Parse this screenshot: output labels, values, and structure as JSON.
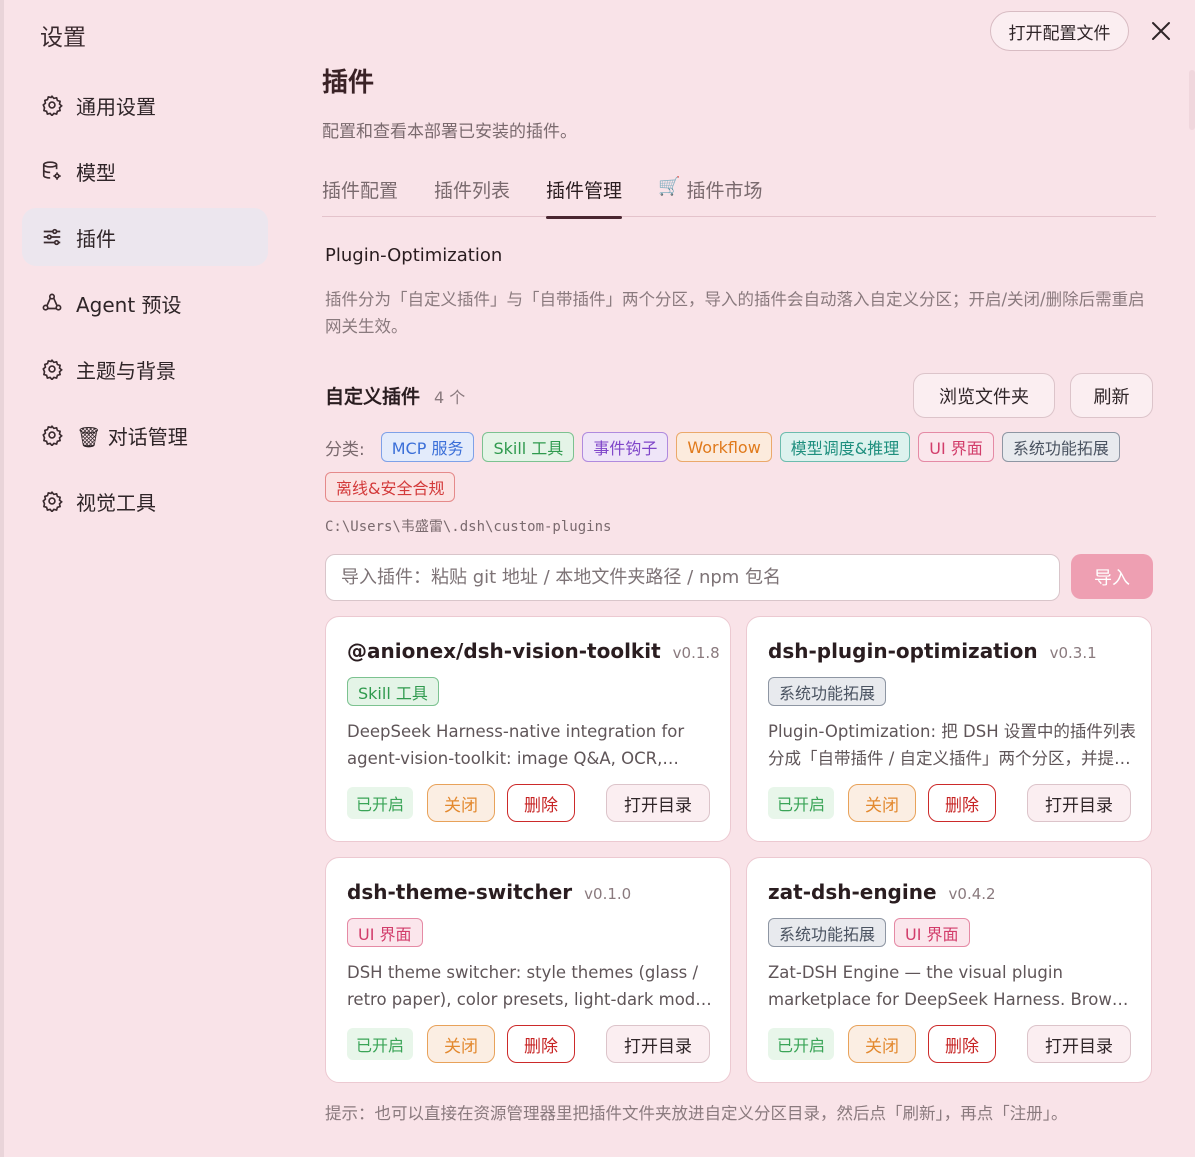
{
  "sidebar": {
    "title": "设置",
    "items": [
      {
        "label": "通用设置",
        "icon": "gear-icon"
      },
      {
        "label": "模型",
        "icon": "database-gear-icon"
      },
      {
        "label": "插件",
        "icon": "sliders-icon",
        "active": true
      },
      {
        "label": "Agent 预设",
        "icon": "agent-icon"
      },
      {
        "label": "主题与背景",
        "icon": "gear-icon"
      },
      {
        "label": "🗑 对话管理",
        "icon": "gear-icon"
      },
      {
        "label": "视觉工具",
        "icon": "gear-icon"
      }
    ]
  },
  "header": {
    "open_config_label": "打开配置文件",
    "close_label": "✕"
  },
  "main": {
    "title": "插件",
    "description": "配置和查看本部署已安装的插件。",
    "tabs": [
      {
        "label": "插件配置"
      },
      {
        "label": "插件列表"
      },
      {
        "label": "插件管理",
        "active": true
      },
      {
        "label": "插件市场",
        "icon": "🛒"
      }
    ]
  },
  "section": {
    "title": "Plugin-Optimization",
    "description": "插件分为「自定义插件」与「自带插件」两个分区，导入的插件会自动落入自定义分区；开启/关闭/删除后需重启网关生效。"
  },
  "custom": {
    "title": "自定义插件",
    "count": "4 个",
    "browse_label": "浏览文件夹",
    "refresh_label": "刷新",
    "category_label": "分类:",
    "categories": [
      {
        "label": "MCP 服务",
        "color": "#3b6fd8",
        "bg": "#e3ebfb"
      },
      {
        "label": "Skill 工具",
        "color": "#2f9a4e",
        "bg": "#e4f4e7"
      },
      {
        "label": "事件钩子",
        "color": "#7f45c9",
        "bg": "#efe5f8"
      },
      {
        "label": "Workflow",
        "color": "#e07a1c",
        "bg": "#fcebdd"
      },
      {
        "label": "模型调度&推理",
        "color": "#1e8f7e",
        "bg": "#ddf2ee"
      },
      {
        "label": "UI 界面",
        "color": "#d23d6b",
        "bg": "#fbe6ec"
      },
      {
        "label": "系统功能拓展",
        "color": "#4a5361",
        "bg": "#e8eaee"
      },
      {
        "label": "离线&安全合规",
        "color": "#d33a3a",
        "bg": "#fbe3e3"
      }
    ],
    "path": "C:\\Users\\韦盛雷\\.dsh\\custom-plugins",
    "import_placeholder": "导入插件：粘贴 git 地址 / 本地文件夹路径 / npm 包名",
    "import_label": "导入"
  },
  "plugins": [
    {
      "name": "@anionex/dsh-vision-toolkit",
      "version": "v0.1.8",
      "tags": [
        {
          "label": "Skill 工具",
          "color": "#2f9a4e",
          "bg": "#e4f4e7"
        }
      ],
      "description": "DeepSeek Harness-native integration for agent-vision-toolkit: image Q&A, OCR, object detection and more.",
      "status": "已开启",
      "close_label": "关闭",
      "delete_label": "删除",
      "open_dir_label": "打开目录"
    },
    {
      "name": "dsh-plugin-optimization",
      "version": "v0.3.1",
      "tags": [
        {
          "label": "系统功能拓展",
          "color": "#4a5361",
          "bg": "#e8eaee"
        }
      ],
      "description": "Plugin-Optimization: 把 DSH 设置中的插件列表分成「自带插件 / 自定义插件」两个分区，并提供导入与管理。",
      "status": "已开启",
      "close_label": "关闭",
      "delete_label": "删除",
      "open_dir_label": "打开目录"
    },
    {
      "name": "dsh-theme-switcher",
      "version": "v0.1.0",
      "tags": [
        {
          "label": "UI 界面",
          "color": "#d23d6b",
          "bg": "#fbe6ec"
        }
      ],
      "description": "DSH theme switcher: style themes (glass / retro paper), color presets, light-dark mode and more.",
      "status": "已开启",
      "close_label": "关闭",
      "delete_label": "删除",
      "open_dir_label": "打开目录"
    },
    {
      "name": "zat-dsh-engine",
      "version": "v0.4.2",
      "tags": [
        {
          "label": "系统功能拓展",
          "color": "#4a5361",
          "bg": "#e8eaee"
        },
        {
          "label": "UI 界面",
          "color": "#d23d6b",
          "bg": "#fbe6ec"
        }
      ],
      "description": "Zat-DSH Engine — the visual plugin marketplace for DeepSeek Harness. Browse, install and manage plugins.",
      "status": "已开启",
      "close_label": "关闭",
      "delete_label": "删除",
      "open_dir_label": "打开目录"
    }
  ],
  "hint": "提示：也可以直接在资源管理器里把插件文件夹放进自定义分区目录，然后点「刷新」，再点「注册」。"
}
